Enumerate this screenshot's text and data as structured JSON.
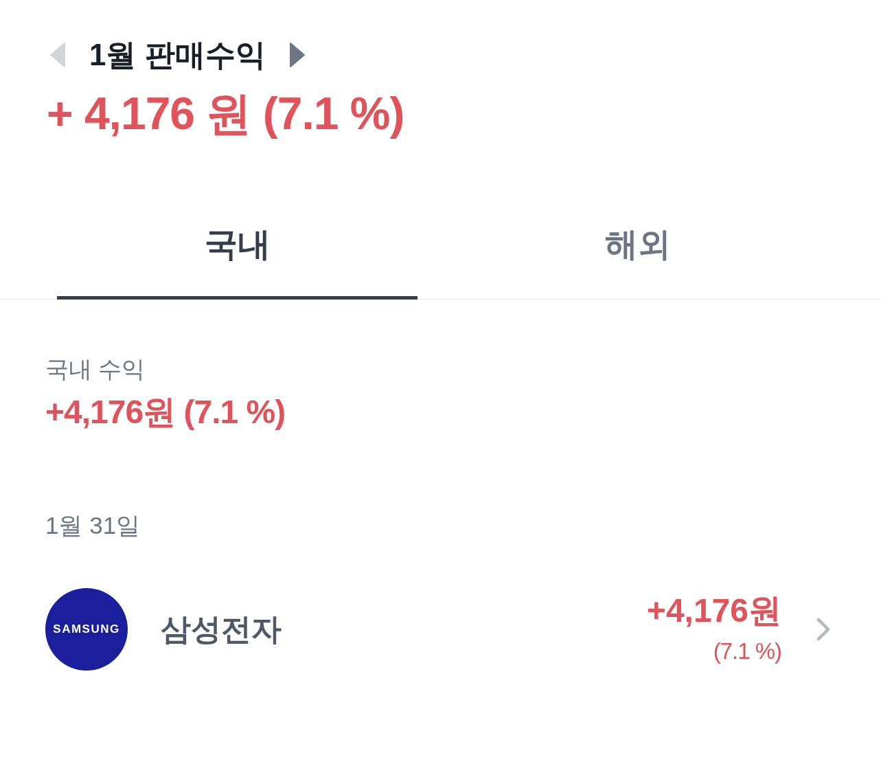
{
  "header": {
    "title": "1월 판매수익",
    "prev_button": {
      "disabled": true
    },
    "next_button": {
      "disabled": false
    },
    "total": "+ 4,176 원 (7.1 %)"
  },
  "tabs": [
    {
      "label": "국내",
      "selected": true
    },
    {
      "label": "해외",
      "selected": false
    }
  ],
  "summary": {
    "label": "국내 수익",
    "value": "+4,176원 (7.1 %)"
  },
  "date_groups": [
    {
      "date": "1월 31일",
      "items": [
        {
          "name": "삼성전자",
          "logo_text": "SAMSUNG",
          "amount": "+4,176원",
          "rate": "(7.1 %)"
        }
      ]
    }
  ]
}
